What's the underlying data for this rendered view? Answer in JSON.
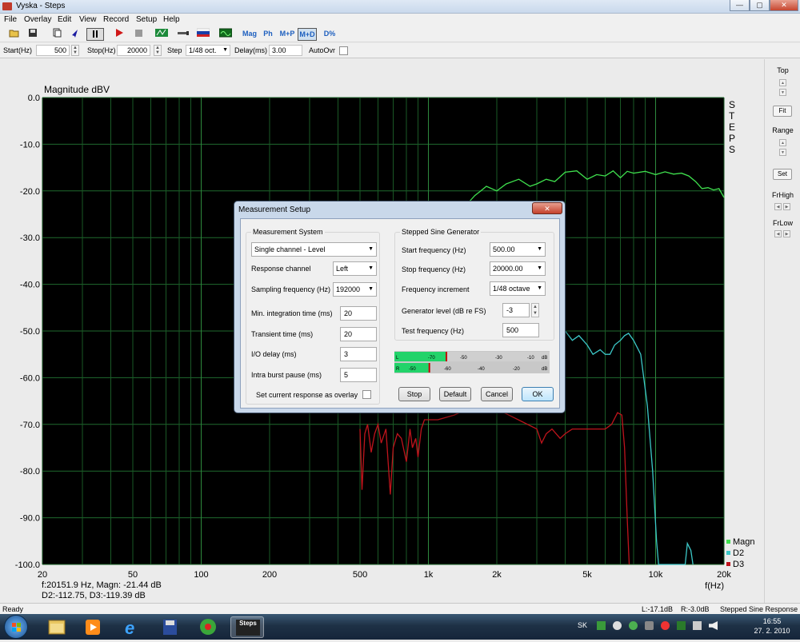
{
  "window": {
    "title": "Vyska - Steps",
    "minimize": "—",
    "maximize": "▢",
    "close": "✕"
  },
  "menu": [
    "File",
    "Overlay",
    "Edit",
    "View",
    "Record",
    "Setup",
    "Help"
  ],
  "toolbar": {
    "mag": "Mag",
    "ph": "Ph",
    "mp": "M+P",
    "md": "M+D",
    "dpct": "D%"
  },
  "params": {
    "start_label": "Start(Hz)",
    "start_value": "500",
    "stop_label": "Stop(Hz)",
    "stop_value": "20000",
    "step_label": "Step",
    "step_value": "1/48 oct.",
    "delay_label": "Delay(ms)",
    "delay_value": "3.00",
    "autoovr_label": "AutoOvr"
  },
  "right_panel": {
    "top": "Top",
    "fit": "Fit",
    "range": "Range",
    "set": "Set",
    "frhigh": "FrHigh",
    "frlow": "FrLow"
  },
  "chart_data": {
    "type": "line",
    "ylabel": "Magnitude dBV",
    "xlabel": "f(Hz)",
    "side_label": "STEPS",
    "x_scale": "log",
    "xlim": [
      20,
      20000
    ],
    "ylim": [
      -100,
      0
    ],
    "x_ticks": [
      20,
      50,
      100,
      200,
      500,
      1000,
      2000,
      5000,
      10000,
      20000
    ],
    "x_tick_labels": [
      "20",
      "50",
      "100",
      "200",
      "500",
      "1k",
      "2k",
      "5k",
      "10k",
      "20k"
    ],
    "y_ticks": [
      0,
      -10,
      -20,
      -30,
      -40,
      -50,
      -60,
      -70,
      -80,
      -90,
      -100
    ],
    "y_tick_labels": [
      "0.0",
      "-10.0",
      "-20.0",
      "-30.0",
      "-40.0",
      "-50.0",
      "-60.0",
      "-70.0",
      "-80.0",
      "-90.0",
      "-100.0"
    ],
    "grid": true,
    "background": "#000000",
    "legend_position": "bottom-right",
    "series": [
      {
        "name": "D3",
        "color": "#c0141c",
        "points": [
          [
            500,
            -71
          ],
          [
            510,
            -84
          ],
          [
            525,
            -72
          ],
          [
            540,
            -70
          ],
          [
            560,
            -76
          ],
          [
            580,
            -72
          ],
          [
            600,
            -70
          ],
          [
            620,
            -74
          ],
          [
            650,
            -71
          ],
          [
            680,
            -85
          ],
          [
            700,
            -75
          ],
          [
            730,
            -72
          ],
          [
            760,
            -73
          ],
          [
            800,
            -78
          ],
          [
            830,
            -71
          ],
          [
            850,
            -75
          ],
          [
            880,
            -73
          ],
          [
            900,
            -77
          ],
          [
            930,
            -71
          ],
          [
            960,
            -69
          ],
          [
            1000,
            -69
          ],
          [
            1100,
            -69
          ],
          [
            1300,
            -68
          ],
          [
            1600,
            -66
          ],
          [
            1700,
            -65
          ],
          [
            3000,
            -71
          ],
          [
            3150,
            -74
          ],
          [
            3300,
            -72
          ],
          [
            3500,
            -71
          ],
          [
            3800,
            -73
          ],
          [
            4000,
            -72
          ],
          [
            4300,
            -71
          ],
          [
            4600,
            -71
          ],
          [
            5000,
            -71
          ],
          [
            5500,
            -71
          ],
          [
            6000,
            -71
          ],
          [
            6400,
            -70
          ],
          [
            6800,
            -67.5
          ],
          [
            7100,
            -68
          ],
          [
            7300,
            -75
          ],
          [
            7500,
            -90
          ],
          [
            7650,
            -100
          ]
        ]
      },
      {
        "name": "D2",
        "color": "#3cc8c8",
        "points": [
          [
            4000,
            -50
          ],
          [
            4300,
            -52
          ],
          [
            4600,
            -51
          ],
          [
            5000,
            -53
          ],
          [
            5300,
            -55
          ],
          [
            5700,
            -54
          ],
          [
            6000,
            -55
          ],
          [
            6300,
            -55
          ],
          [
            6600,
            -53
          ],
          [
            7000,
            -52
          ],
          [
            7300,
            -51
          ],
          [
            7600,
            -50.5
          ],
          [
            8000,
            -52
          ],
          [
            8600,
            -55
          ],
          [
            9200,
            -66
          ],
          [
            9700,
            -80
          ],
          [
            10100,
            -95
          ],
          [
            10300,
            -100
          ],
          [
            13500,
            -100
          ],
          [
            13800,
            -95.5
          ],
          [
            14300,
            -97
          ],
          [
            14600,
            -100
          ]
        ]
      },
      {
        "name": "Magn",
        "color": "#3fe14e",
        "points": [
          [
            1500,
            -22.5
          ],
          [
            1600,
            -21
          ],
          [
            1700,
            -20
          ],
          [
            1800,
            -19
          ],
          [
            2000,
            -20
          ],
          [
            2200,
            -18.5
          ],
          [
            2500,
            -17.5
          ],
          [
            2800,
            -19
          ],
          [
            3000,
            -18.5
          ],
          [
            3300,
            -17.5
          ],
          [
            3600,
            -18
          ],
          [
            4000,
            -16
          ],
          [
            4500,
            -15.7
          ],
          [
            5000,
            -17.5
          ],
          [
            5500,
            -16.5
          ],
          [
            6000,
            -16.8
          ],
          [
            6500,
            -15.7
          ],
          [
            7000,
            -17.2
          ],
          [
            7500,
            -15.8
          ],
          [
            8000,
            -16.2
          ],
          [
            9000,
            -15.8
          ],
          [
            10000,
            -16.5
          ],
          [
            11000,
            -15.9
          ],
          [
            12000,
            -16.4
          ],
          [
            13000,
            -16.2
          ],
          [
            14000,
            -16.8
          ],
          [
            15000,
            -18
          ],
          [
            16000,
            -19.5
          ],
          [
            17000,
            -19.3
          ],
          [
            18000,
            -19.8
          ],
          [
            19000,
            -19.5
          ],
          [
            20000,
            -21.4
          ]
        ]
      }
    ]
  },
  "readout": {
    "line1": "f:20151.9 Hz, Magn: -21.44 dB",
    "line2": "D2:-112.75, D3:-119.39 dB"
  },
  "dialog": {
    "title": "Measurement Setup",
    "close": "✕",
    "left": {
      "group": "Measurement System",
      "system_value": "Single channel - Level",
      "response_channel_label": "Response channel",
      "response_channel_value": "Left",
      "sampling_label": "Sampling frequency (Hz)",
      "sampling_value": "192000",
      "min_int_label": "Min. integration time (ms)",
      "min_int_value": "20",
      "transient_label": "Transient time (ms)",
      "transient_value": "20",
      "io_delay_label": "I/O delay (ms)",
      "io_delay_value": "3",
      "intra_label": "Intra burst pause (ms)",
      "intra_value": "5",
      "overlay_label": "Set current response as overlay"
    },
    "right": {
      "group": "Stepped Sine Generator",
      "start_label": "Start frequency (Hz)",
      "start_value": "500.00",
      "stop_label": "Stop frequency (Hz)",
      "stop_value": "20000.00",
      "incr_label": "Frequency increment",
      "incr_value": "1/48 octave",
      "gen_label": "Generator level (dB re FS)",
      "gen_value": "-3",
      "test_label": "Test frequency (Hz)",
      "test_value": "500"
    },
    "meter": {
      "left_tag": "L",
      "right_tag": "R",
      "top_scale": [
        "-70",
        "-50",
        "-30",
        "-10",
        "dB"
      ],
      "bottom_scale": [
        "-50",
        "-60",
        "-40",
        "-20",
        "dB"
      ],
      "left_level": 0.33,
      "right_level": 0.22
    },
    "buttons": {
      "stop": "Stop",
      "default": "Default",
      "cancel": "Cancel",
      "ok": "OK"
    }
  },
  "status": {
    "left": "Ready",
    "l_db": "L:-17.1dB",
    "r_db": "R:-3.0dB",
    "mode": "Stepped Sine Response"
  },
  "taskbar": {
    "lang": "SK",
    "time": "16:55",
    "date": "27. 2. 2010",
    "active_app": "Steps"
  }
}
